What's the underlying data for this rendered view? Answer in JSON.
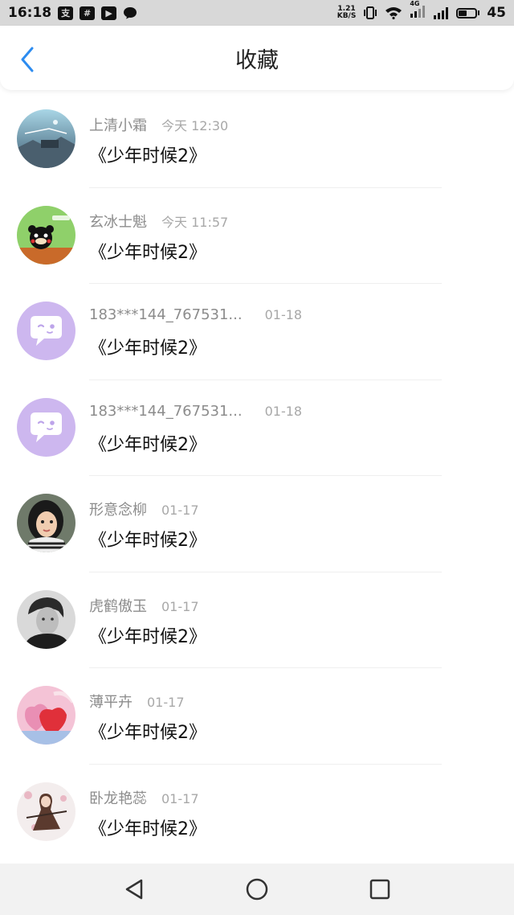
{
  "status_bar": {
    "time": "16:18",
    "net_speed_top": "1.21",
    "net_speed_bottom": "KB/S",
    "network_type": "4G",
    "battery": "45",
    "left_icons": [
      "app-notification-icon",
      "grid-icon",
      "play-icon",
      "chat-icon"
    ],
    "right_icons": [
      "vibrate-icon",
      "wifi-icon",
      "signal-icon",
      "signal-icon",
      "battery-icon"
    ]
  },
  "header": {
    "title": "收藏",
    "back_icon": "chevron-left-icon",
    "accent_color": "#2d8cf0"
  },
  "items": [
    {
      "username": "上清小霜",
      "time": "今天 12:30",
      "title": "《少年时候2》",
      "avatar": "landscape"
    },
    {
      "username": "玄冰士魁",
      "time": "今天 11:57",
      "title": "《少年时候2》",
      "avatar": "bear"
    },
    {
      "username": "183***144_767531...",
      "time": "01-18",
      "title": "《少年时候2》",
      "avatar": "default-chat"
    },
    {
      "username": "183***144_767531...",
      "time": "01-18",
      "title": "《少年时候2》",
      "avatar": "default-chat"
    },
    {
      "username": "形意念柳",
      "time": "01-17",
      "title": "《少年时候2》",
      "avatar": "child"
    },
    {
      "username": "虎鹤傲玉",
      "time": "01-17",
      "title": "《少年时候2》",
      "avatar": "portrait"
    },
    {
      "username": "薄平卉",
      "time": "01-17",
      "title": "《少年时候2》",
      "avatar": "hearts"
    },
    {
      "username": "卧龙艳蕊",
      "time": "01-17",
      "title": "《少年时候2》",
      "avatar": "illustration"
    }
  ],
  "nav_bar": {
    "icons": [
      "back-triangle-icon",
      "home-circle-icon",
      "recents-square-icon"
    ]
  }
}
